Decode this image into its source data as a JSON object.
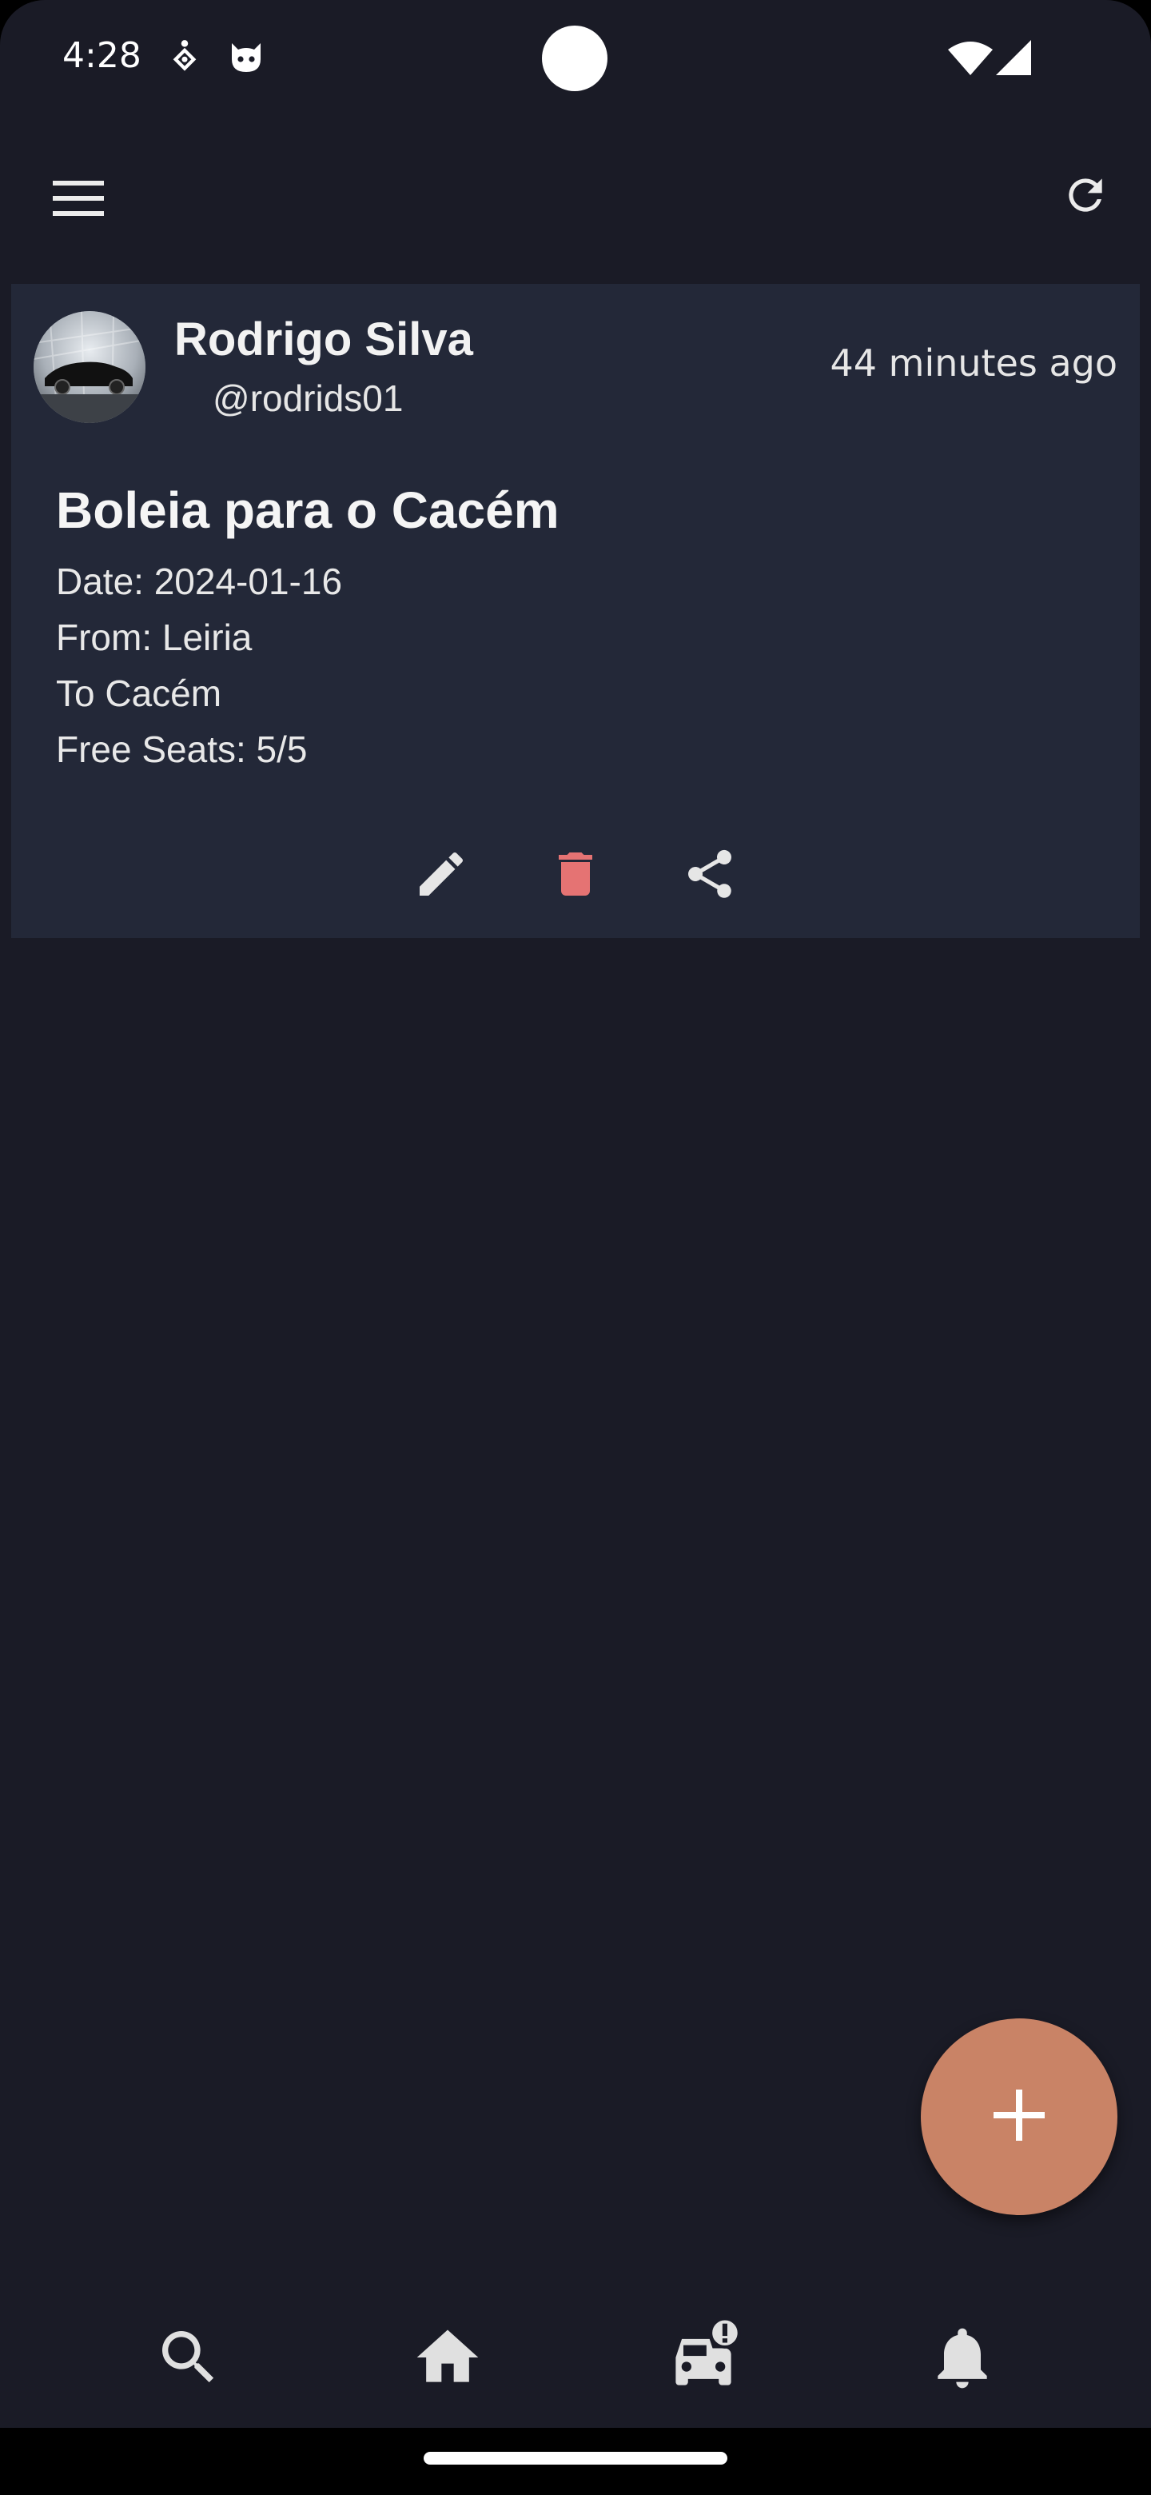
{
  "status_bar": {
    "time": "4:28",
    "icons": [
      "location-person-icon",
      "cat-face-icon",
      "wifi-icon",
      "cellular-signal-icon"
    ]
  },
  "app_bar": {
    "icons": [
      "menu-icon",
      "refresh-icon"
    ]
  },
  "ride": {
    "user_name": "Rodrigo Silva",
    "user_handle": "@rodrids01",
    "time_ago": "44 minutes ago",
    "title": "Boleia para o Cacém",
    "date_line": "Date: 2024-01-16",
    "from_line": "From: Leiria",
    "to_line": "To Cacém",
    "seats_line": "Free Seats: 5/5",
    "actions": [
      "edit-icon",
      "delete-icon",
      "share-icon"
    ]
  },
  "fab": {
    "icon": "plus-icon"
  },
  "bottom_nav": {
    "items": [
      "search-icon",
      "home-icon",
      "car-alert-icon",
      "bell-icon"
    ]
  },
  "colors": {
    "background": "#1a1b26",
    "card": "#232838",
    "accent": "#c98366",
    "delete": "#e57373",
    "icon": "#e0e0e0"
  }
}
